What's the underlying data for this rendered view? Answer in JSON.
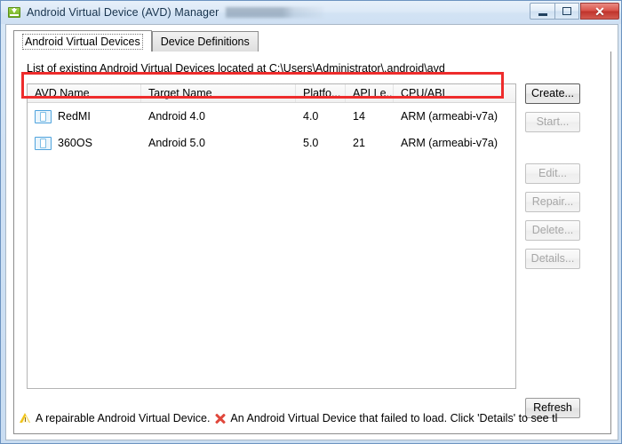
{
  "window": {
    "title": "Android Virtual Device (AVD) Manager",
    "app_icon": "android-download-icon",
    "minimize_label": "–",
    "maximize_label": "□",
    "close_label": "✕"
  },
  "tabs": [
    {
      "label": "Android Virtual Devices",
      "active": true
    },
    {
      "label": "Device Definitions",
      "active": false
    }
  ],
  "panel": {
    "caption": "List of existing Android Virtual Devices located at C:\\Users\\Administrator\\.android\\avd"
  },
  "table": {
    "columns": [
      "AVD Name",
      "Target Name",
      "Platfo...",
      "API Le...",
      "CPU/ABI"
    ],
    "rows": [
      {
        "icon": "android-device-icon",
        "avd_name": "RedMI",
        "target_name": "Android 4.0",
        "platform": "4.0",
        "api_level": "14",
        "cpu_abi": "ARM (armeabi-v7a)",
        "highlighted": true
      },
      {
        "icon": "android-device-icon",
        "avd_name": "360OS",
        "target_name": "Android 5.0",
        "platform": "5.0",
        "api_level": "21",
        "cpu_abi": "ARM (armeabi-v7a)",
        "highlighted": false
      }
    ]
  },
  "buttons": {
    "create": {
      "label": "Create...",
      "disabled": false
    },
    "start": {
      "label": "Start...",
      "disabled": true
    },
    "edit": {
      "label": "Edit...",
      "disabled": true
    },
    "repair": {
      "label": "Repair...",
      "disabled": true
    },
    "delete": {
      "label": "Delete...",
      "disabled": true
    },
    "details": {
      "label": "Details...",
      "disabled": true
    },
    "refresh": {
      "label": "Refresh",
      "disabled": false
    }
  },
  "legend": {
    "repairable_text": "A repairable Android Virtual Device.",
    "failed_text": "An Android Virtual Device that failed to load. Click 'Details' to see tl"
  },
  "colors": {
    "highlight_red": "#ee2c2c",
    "device_icon_blue": "#4fa3dd",
    "warning_yellow": "#f0c419",
    "error_red": "#e0483c",
    "close_button_red": "#c0332c"
  }
}
